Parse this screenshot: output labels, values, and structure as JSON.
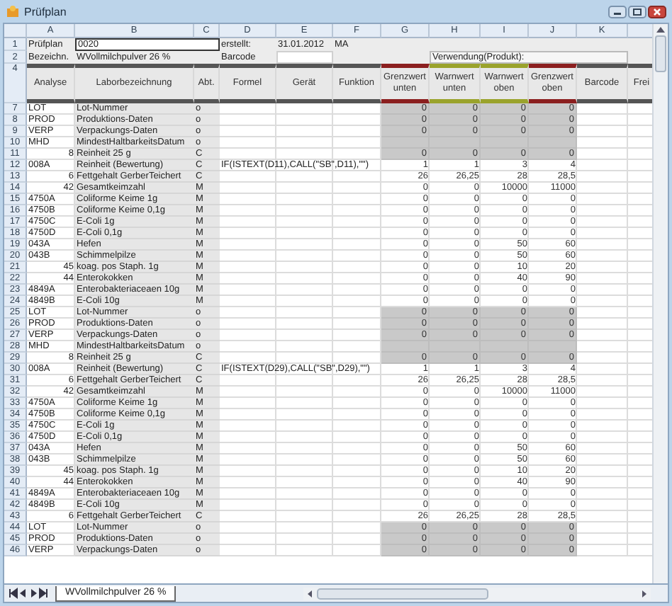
{
  "window": {
    "title": "Prüfplan"
  },
  "column_letters": [
    "A",
    "B",
    "C",
    "D",
    "E",
    "F",
    "G",
    "H",
    "I",
    "J",
    "K"
  ],
  "top_rows": [
    {
      "number": "1",
      "a": "Prüfplan",
      "b": "0020",
      "b_selected": true,
      "d": "erstellt:",
      "e": "31.01.2012",
      "f": "MA"
    },
    {
      "number": "2",
      "a": "Bezeichn.",
      "b": "WVollmilchpulver 26 %",
      "b_selected": false,
      "d": "Barcode",
      "h": "Verwendung(Produkt):"
    }
  ],
  "header_row": {
    "number": "4",
    "columns": [
      {
        "label": "Analyse"
      },
      {
        "label": "Laborbezeichnung"
      },
      {
        "label": "Abt."
      },
      {
        "label": "Formel"
      },
      {
        "label": "Gerät"
      },
      {
        "label": "Funktion"
      },
      {
        "label": "Grenzwert unten",
        "color": "#8b1f1f"
      },
      {
        "label": "Warnwert unten",
        "color": "#9aa32c"
      },
      {
        "label": "Warnwert oben",
        "color": "#9aa32c"
      },
      {
        "label": "Grenzwert oben",
        "color": "#8b1f1f"
      },
      {
        "label": "Barcode"
      },
      {
        "label": "Frei"
      }
    ]
  },
  "rows": [
    {
      "number": "7",
      "analyse": "LOT",
      "kind": "code",
      "name": "Lot-Nummer",
      "abt": "o",
      "shaded": true,
      "limits": [
        "0",
        "0",
        "0",
        "0"
      ]
    },
    {
      "number": "8",
      "analyse": "PROD",
      "kind": "code",
      "name": "Produktions-Daten",
      "abt": "o",
      "shaded": true,
      "limits": [
        "0",
        "0",
        "0",
        "0"
      ]
    },
    {
      "number": "9",
      "analyse": "VERP",
      "kind": "code",
      "name": "Verpackungs-Daten",
      "abt": "o",
      "shaded": true,
      "limits": [
        "0",
        "0",
        "0",
        "0"
      ]
    },
    {
      "number": "10",
      "analyse": "MHD",
      "kind": "code",
      "name": "MindestHaltbarkeitsDatum",
      "abt": "o",
      "shaded": true
    },
    {
      "number": "11",
      "analyse": "8",
      "kind": "number",
      "name": "Reinheit 25 g",
      "abt": "C",
      "shaded": true,
      "limits": [
        "0",
        "0",
        "0",
        "0"
      ]
    },
    {
      "number": "12",
      "analyse": "008A",
      "kind": "code",
      "name": "Reinheit (Bewertung)",
      "abt": "C",
      "formula": "IF(ISTEXT(D11),CALL(\"SB\",D11),\"\")",
      "shaded": false,
      "limits": [
        "1",
        "1",
        "3",
        "4"
      ]
    },
    {
      "number": "13",
      "analyse": "6",
      "kind": "number",
      "name": "Fettgehalt GerberTeichert",
      "abt": "C",
      "shaded": false,
      "limits": [
        "26",
        "26,25",
        "28",
        "28,5"
      ]
    },
    {
      "number": "14",
      "analyse": "42",
      "kind": "number",
      "name": "Gesamtkeimzahl",
      "abt": "M",
      "shaded": false,
      "limits": [
        "0",
        "0",
        "10000",
        "11000"
      ]
    },
    {
      "number": "15",
      "analyse": "4750A",
      "kind": "code",
      "name": "Coliforme Keime 1g",
      "abt": "M",
      "shaded": false,
      "limits": [
        "0",
        "0",
        "0",
        "0"
      ]
    },
    {
      "number": "16",
      "analyse": "4750B",
      "kind": "code",
      "name": "Coliforme Keime 0,1g",
      "abt": "M",
      "shaded": false,
      "limits": [
        "0",
        "0",
        "0",
        "0"
      ]
    },
    {
      "number": "17",
      "analyse": "4750C",
      "kind": "code",
      "name": "E-Coli 1g",
      "abt": "M",
      "shaded": false,
      "limits": [
        "0",
        "0",
        "0",
        "0"
      ]
    },
    {
      "number": "18",
      "analyse": "4750D",
      "kind": "code",
      "name": "E-Coli 0,1g",
      "abt": "M",
      "shaded": false,
      "limits": [
        "0",
        "0",
        "0",
        "0"
      ]
    },
    {
      "number": "19",
      "analyse": "043A",
      "kind": "code",
      "name": "Hefen",
      "abt": "M",
      "shaded": false,
      "limits": [
        "0",
        "0",
        "50",
        "60"
      ]
    },
    {
      "number": "20",
      "analyse": "043B",
      "kind": "code",
      "name": "Schimmelpilze",
      "abt": "M",
      "shaded": false,
      "limits": [
        "0",
        "0",
        "50",
        "60"
      ]
    },
    {
      "number": "21",
      "analyse": "45",
      "kind": "number",
      "name": "koag. pos Staph. 1g",
      "abt": "M",
      "shaded": false,
      "limits": [
        "0",
        "0",
        "10",
        "20"
      ]
    },
    {
      "number": "22",
      "analyse": "44",
      "kind": "number",
      "name": "Enterokokken",
      "abt": "M",
      "shaded": false,
      "limits": [
        "0",
        "0",
        "40",
        "90"
      ]
    },
    {
      "number": "23",
      "analyse": "4849A",
      "kind": "code",
      "name": "Enterobakteriaceaen 10g",
      "abt": "M",
      "shaded": false,
      "limits": [
        "0",
        "0",
        "0",
        "0"
      ]
    },
    {
      "number": "24",
      "analyse": "4849B",
      "kind": "code",
      "name": "E-Coli 10g",
      "abt": "M",
      "shaded": false,
      "limits": [
        "0",
        "0",
        "0",
        "0"
      ]
    },
    {
      "number": "25",
      "analyse": "LOT",
      "kind": "code",
      "name": "Lot-Nummer",
      "abt": "o",
      "shaded": true,
      "limits": [
        "0",
        "0",
        "0",
        "0"
      ]
    },
    {
      "number": "26",
      "analyse": "PROD",
      "kind": "code",
      "name": "Produktions-Daten",
      "abt": "o",
      "shaded": true,
      "limits": [
        "0",
        "0",
        "0",
        "0"
      ]
    },
    {
      "number": "27",
      "analyse": "VERP",
      "kind": "code",
      "name": "Verpackungs-Daten",
      "abt": "o",
      "shaded": true,
      "limits": [
        "0",
        "0",
        "0",
        "0"
      ]
    },
    {
      "number": "28",
      "analyse": "MHD",
      "kind": "code",
      "name": "MindestHaltbarkeitsDatum",
      "abt": "o",
      "shaded": true
    },
    {
      "number": "29",
      "analyse": "8",
      "kind": "number",
      "name": "Reinheit 25 g",
      "abt": "C",
      "shaded": true,
      "limits": [
        "0",
        "0",
        "0",
        "0"
      ]
    },
    {
      "number": "30",
      "analyse": "008A",
      "kind": "code",
      "name": "Reinheit (Bewertung)",
      "abt": "C",
      "formula": "IF(ISTEXT(D29),CALL(\"SB\",D29),\"\")",
      "shaded": false,
      "limits": [
        "1",
        "1",
        "3",
        "4"
      ]
    },
    {
      "number": "31",
      "analyse": "6",
      "kind": "number",
      "name": "Fettgehalt GerberTeichert",
      "abt": "C",
      "shaded": false,
      "limits": [
        "26",
        "26,25",
        "28",
        "28,5"
      ]
    },
    {
      "number": "32",
      "analyse": "42",
      "kind": "number",
      "name": "Gesamtkeimzahl",
      "abt": "M",
      "shaded": false,
      "limits": [
        "0",
        "0",
        "10000",
        "11000"
      ]
    },
    {
      "number": "33",
      "analyse": "4750A",
      "kind": "code",
      "name": "Coliforme Keime 1g",
      "abt": "M",
      "shaded": false,
      "limits": [
        "0",
        "0",
        "0",
        "0"
      ]
    },
    {
      "number": "34",
      "analyse": "4750B",
      "kind": "code",
      "name": "Coliforme Keime 0,1g",
      "abt": "M",
      "shaded": false,
      "limits": [
        "0",
        "0",
        "0",
        "0"
      ]
    },
    {
      "number": "35",
      "analyse": "4750C",
      "kind": "code",
      "name": "E-Coli 1g",
      "abt": "M",
      "shaded": false,
      "limits": [
        "0",
        "0",
        "0",
        "0"
      ]
    },
    {
      "number": "36",
      "analyse": "4750D",
      "kind": "code",
      "name": "E-Coli 0,1g",
      "abt": "M",
      "shaded": false,
      "limits": [
        "0",
        "0",
        "0",
        "0"
      ]
    },
    {
      "number": "37",
      "analyse": "043A",
      "kind": "code",
      "name": "Hefen",
      "abt": "M",
      "shaded": false,
      "limits": [
        "0",
        "0",
        "50",
        "60"
      ]
    },
    {
      "number": "38",
      "analyse": "043B",
      "kind": "code",
      "name": "Schimmelpilze",
      "abt": "M",
      "shaded": false,
      "limits": [
        "0",
        "0",
        "50",
        "60"
      ]
    },
    {
      "number": "39",
      "analyse": "45",
      "kind": "number",
      "name": "koag. pos Staph. 1g",
      "abt": "M",
      "shaded": false,
      "limits": [
        "0",
        "0",
        "10",
        "20"
      ]
    },
    {
      "number": "40",
      "analyse": "44",
      "kind": "number",
      "name": "Enterokokken",
      "abt": "M",
      "shaded": false,
      "limits": [
        "0",
        "0",
        "40",
        "90"
      ]
    },
    {
      "number": "41",
      "analyse": "4849A",
      "kind": "code",
      "name": "Enterobakteriaceaen 10g",
      "abt": "M",
      "shaded": false,
      "limits": [
        "0",
        "0",
        "0",
        "0"
      ]
    },
    {
      "number": "42",
      "analyse": "4849B",
      "kind": "code",
      "name": "E-Coli 10g",
      "abt": "M",
      "shaded": false,
      "limits": [
        "0",
        "0",
        "0",
        "0"
      ]
    },
    {
      "number": "43",
      "analyse": "6",
      "kind": "number",
      "name": "Fettgehalt GerberTeichert",
      "abt": "C",
      "shaded": false,
      "limits": [
        "26",
        "26,25",
        "28",
        "28,5"
      ]
    },
    {
      "number": "44",
      "analyse": "LOT",
      "kind": "code",
      "name": "Lot-Nummer",
      "abt": "o",
      "shaded": true,
      "limits": [
        "0",
        "0",
        "0",
        "0"
      ]
    },
    {
      "number": "45",
      "analyse": "PROD",
      "kind": "code",
      "name": "Produktions-Daten",
      "abt": "o",
      "shaded": true,
      "limits": [
        "0",
        "0",
        "0",
        "0"
      ]
    },
    {
      "number": "46",
      "analyse": "VERP",
      "kind": "code",
      "name": "Verpackungs-Daten",
      "abt": "o",
      "shaded": true,
      "limits": [
        "0",
        "0",
        "0",
        "0"
      ]
    }
  ],
  "sheet_tabs": [
    {
      "label": "WVollmilchpulver 26 %",
      "selected": true
    }
  ]
}
